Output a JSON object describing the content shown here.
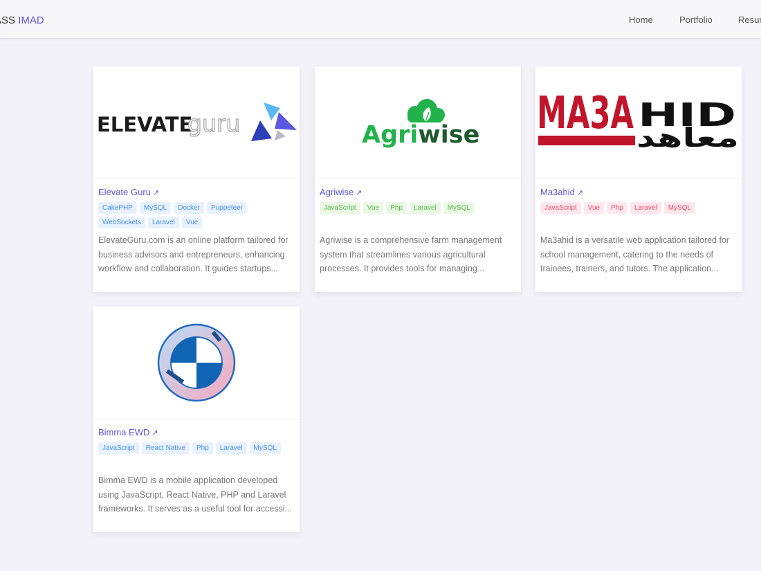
{
  "nav": {
    "brand_prefix": "ASS",
    "brand_accent": "IMAD",
    "links": [
      "Home",
      "Portfolio",
      "Resume"
    ]
  },
  "colors": {
    "accent": "#5b54d6",
    "tag_blue": "#4a8ee8",
    "tag_green": "#5cb84d",
    "tag_red": "#e0506e"
  },
  "cards": [
    {
      "title": "Elevate Guru",
      "arrow": "↗",
      "logo": {
        "word1": "ELEVATE",
        "word2": "guru"
      },
      "tags": [
        "CakePHP",
        "MySQL",
        "Docker",
        "Puppeteer",
        "WebSockets",
        "Laravel",
        "Vue"
      ],
      "description": "ElevateGuru.com is an online platform tailored for business advisors and entrepreneurs, enhancing workflow and collaboration. It guides startups..."
    },
    {
      "title": "Agriwise",
      "arrow": "↗",
      "logo": {
        "word1": "Agri",
        "word2": "wise"
      },
      "tags": [
        "JavaScript",
        "Vue",
        "Php",
        "Laravel",
        "MySQL"
      ],
      "description": "Agriwise is a comprehensive farm management system that streamlines various agricultural processes. It provides tools for managing..."
    },
    {
      "title": "Ma3ahid",
      "arrow": "↗",
      "logo": {
        "word1": "MA3A",
        "word2": "HID",
        "arabic": "معاهد"
      },
      "tags": [
        "JavaScript",
        "Vue",
        "Php",
        "Laravel",
        "MySQL"
      ],
      "description": "Ma3ahid is a versatile web application tailored for school management, catering to the needs of trainees, trainers, and tutors. The application..."
    },
    {
      "title": "Bimma EWD",
      "arrow": "↗",
      "tags": [
        "JavaScript",
        "React Native",
        "Php",
        "Laravel",
        "MySQL"
      ],
      "description": "Bimma EWD is a mobile application developed using JavaScript, React Native, PHP and Laravel frameworks. It serves as a useful tool for accessi..."
    }
  ]
}
